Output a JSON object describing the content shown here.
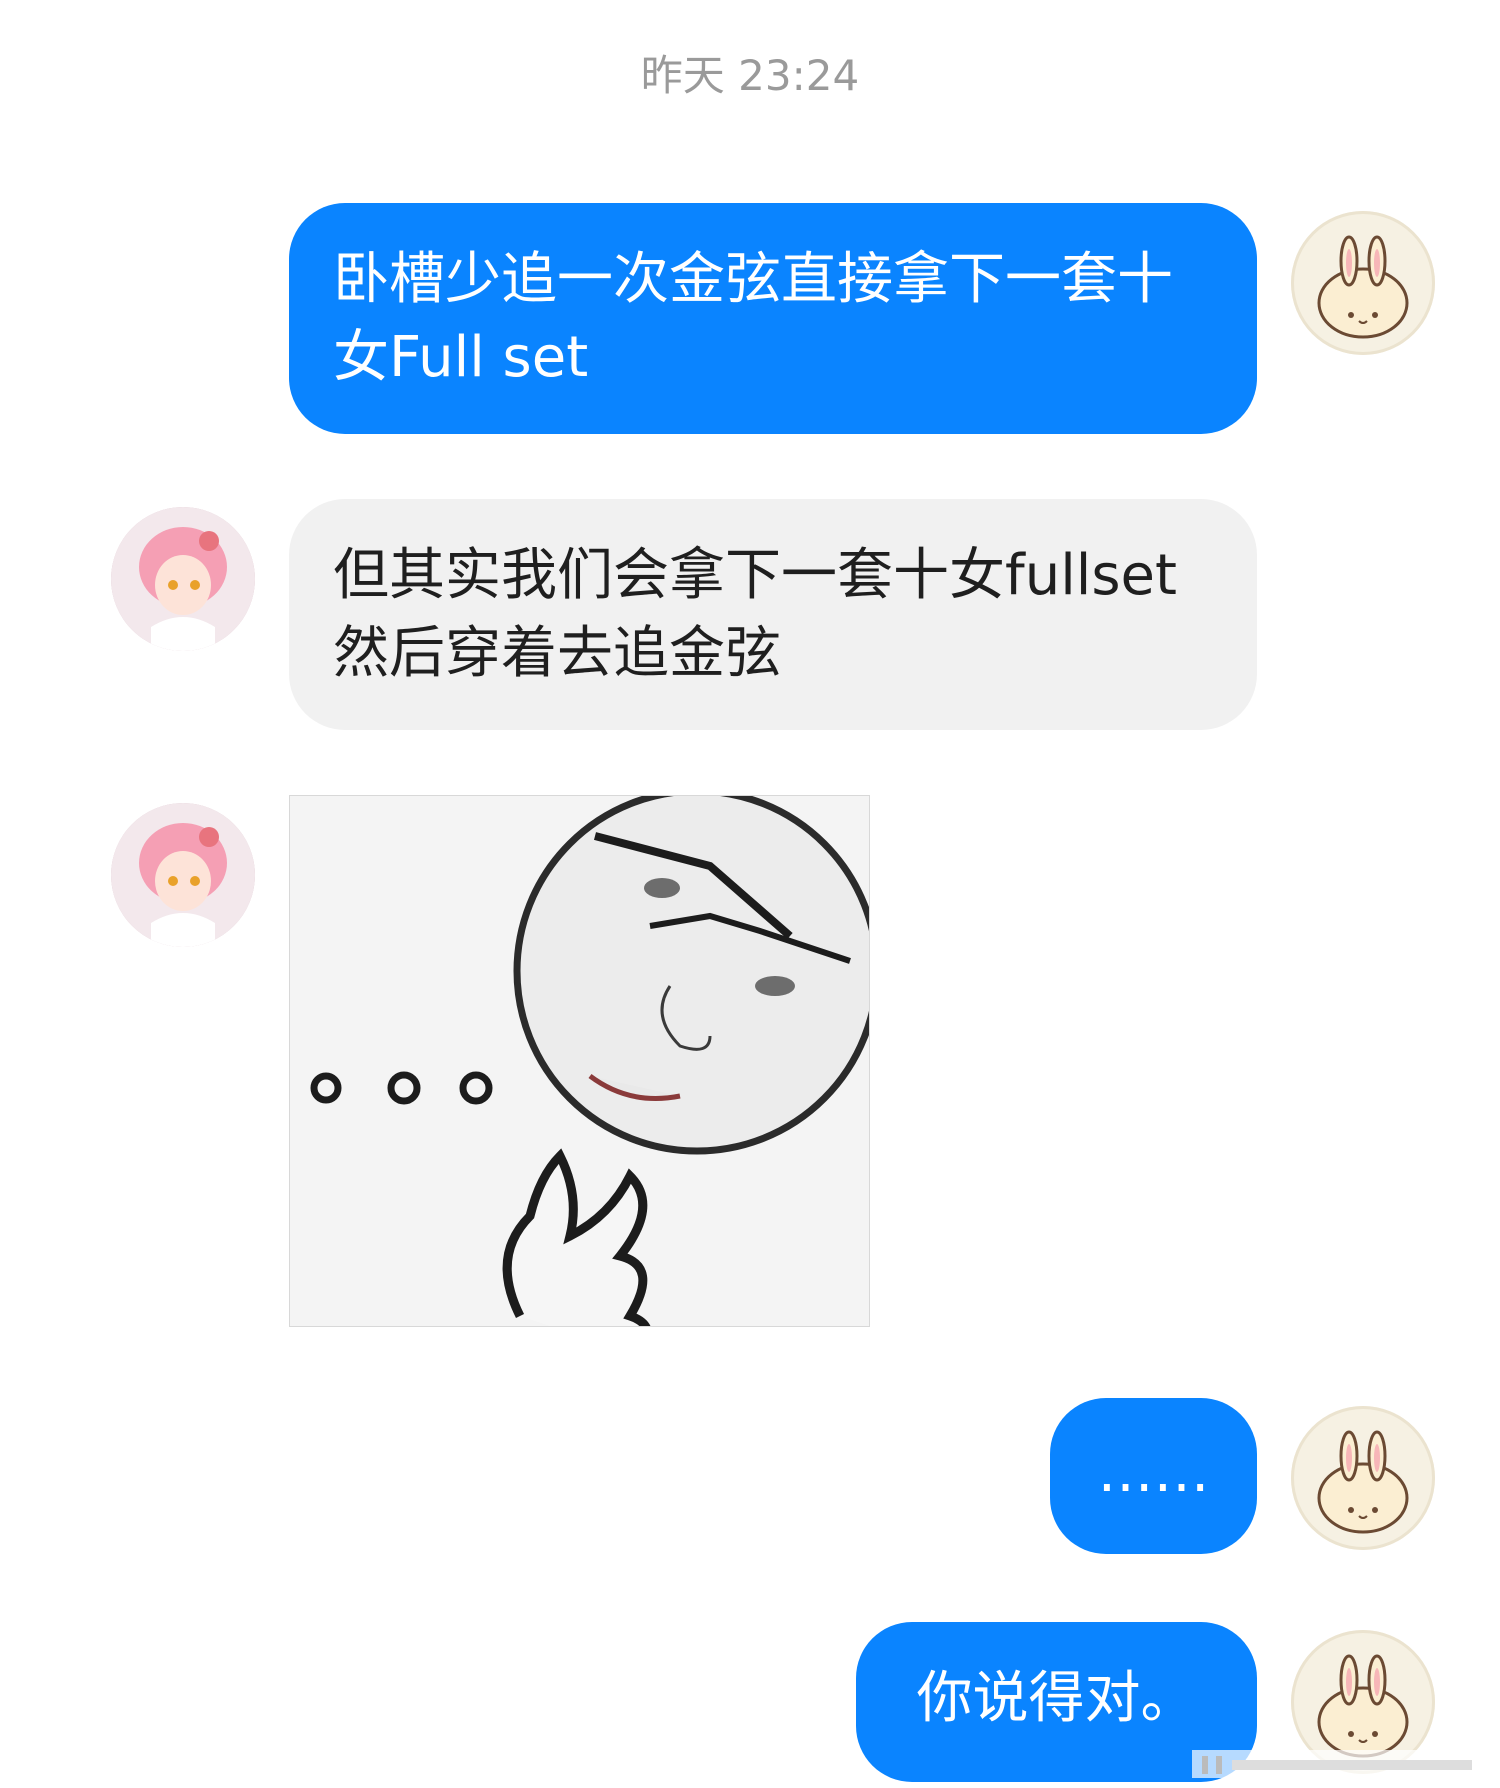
{
  "chat": {
    "timestamp": "昨天 23:24",
    "messages": [
      {
        "sender": "self",
        "type": "text",
        "text": "卧槽少追一次金弦直接拿下一套十女Full set"
      },
      {
        "sender": "other",
        "type": "text",
        "text": "但其实我们会拿下一套十女fullset然后穿着去追金弦"
      },
      {
        "sender": "other",
        "type": "sticker",
        "text": ""
      },
      {
        "sender": "self",
        "type": "text",
        "text": "……"
      },
      {
        "sender": "self",
        "type": "text",
        "text": "你说得对。"
      }
    ]
  },
  "colors": {
    "outgoing_bubble": "#0a84ff",
    "incoming_bubble": "#f1f1f1",
    "timestamp": "#9a9a9a"
  },
  "icons": {
    "self_avatar": "bunny-avatar",
    "other_avatar": "anime-girl-avatar"
  }
}
